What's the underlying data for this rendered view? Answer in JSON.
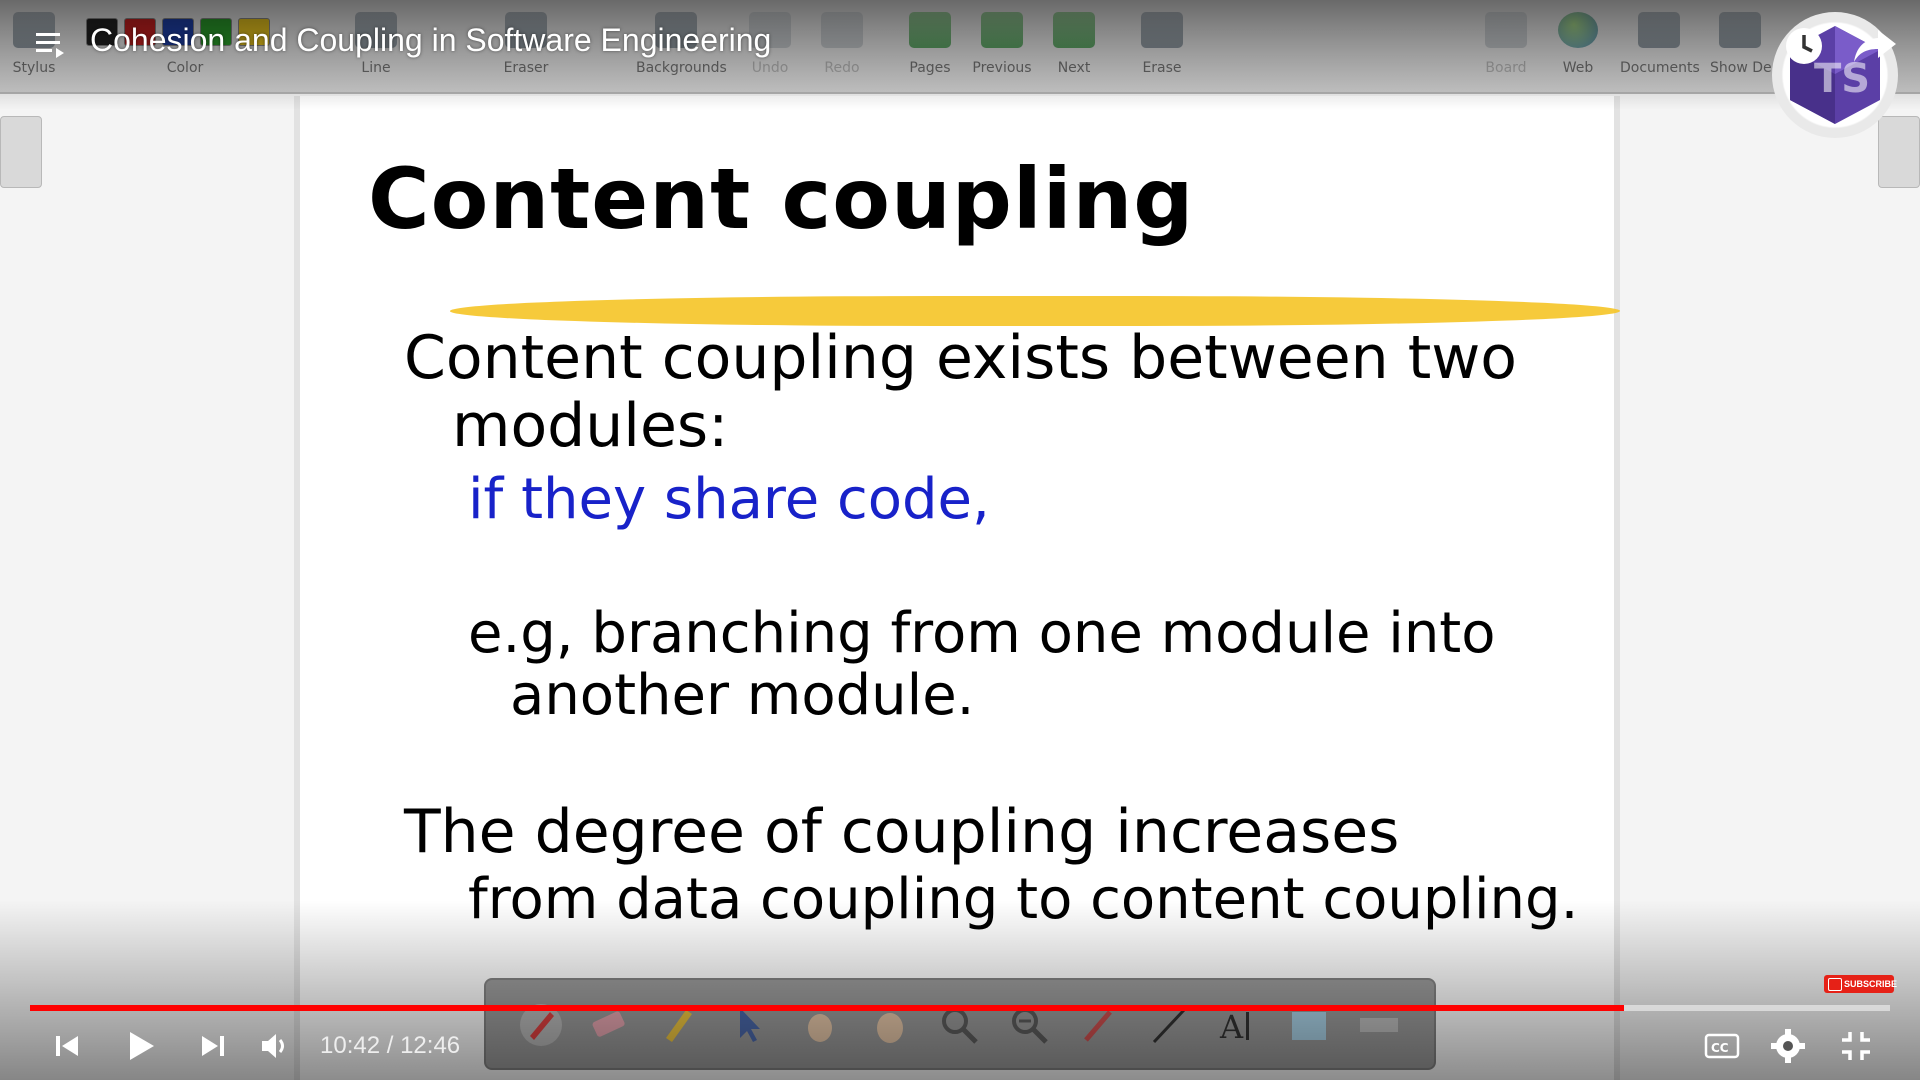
{
  "video": {
    "title": "Cohesion and Coupling in Software Engineering",
    "progress": 0.857,
    "time_current": "10:42",
    "time_separator": " / ",
    "time_total": "12:46"
  },
  "toolbar": {
    "labels": {
      "stylus": "Stylus",
      "color": "Color",
      "line": "Line",
      "eraser": "Eraser",
      "backgrounds": "Backgrounds",
      "undo": "Undo",
      "redo": "Redo",
      "pages": "Pages",
      "previous": "Previous",
      "next": "Next",
      "erase": "Erase",
      "board": "Board",
      "web": "Web",
      "documents": "Documents",
      "show_desktop": "Show De"
    }
  },
  "slide": {
    "title": "Content coupling",
    "line1": "Content coupling exists between two",
    "line2": "modules:",
    "line3": "if  they share code,",
    "line4": "e.g, branching from one module into",
    "line5": "another module.",
    "line6": "The degree of coupling increases",
    "line7": "from data coupling to content coupling."
  },
  "overlay": {
    "subscribe_watermark": "SUBSCRIBE"
  },
  "colors": {
    "progress": "#ff0000",
    "highlight": "#f5c52a",
    "slide_blue": "#1822c9"
  },
  "icons": [
    "playlist-icon",
    "watch-later-icon",
    "share-icon",
    "previous-icon",
    "play-icon",
    "next-icon",
    "volume-icon",
    "captions-icon",
    "settings-icon",
    "exit-fullscreen-icon"
  ]
}
